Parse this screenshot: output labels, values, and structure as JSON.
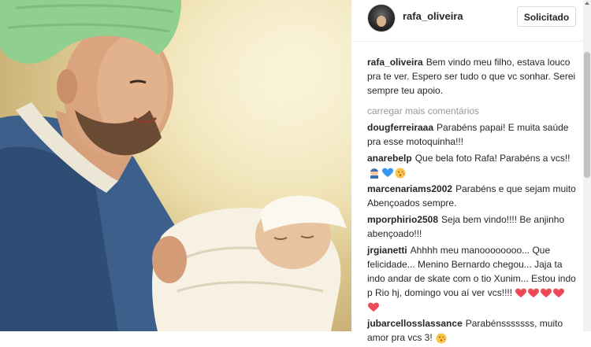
{
  "post": {
    "username": "rafa_oliveira",
    "follow_button": "Solicitado",
    "caption_user": "rafa_oliveira",
    "caption_text": "Bem vindo meu filho, estava louco pra te ver. Espero ser tudo o que vc sonhar. Serei sempre teu apoio.",
    "load_more": "carregar mais comentários"
  },
  "comments": [
    {
      "user": "dougferreiraaa",
      "text": "Parabéns papai! E muita saúde pra esse motoquinha!!!"
    },
    {
      "user": "anarebelp",
      "text": "Que bela foto Rafa! Parabéns a vcs!!"
    },
    {
      "user": "marcenariams2002",
      "text": "Parabéns e que sejam muito Abençoados sempre."
    },
    {
      "user": "mporphirio2508",
      "text": "Seja bem vindo!!!! Be anjinho abençoado!!!"
    },
    {
      "user": "jrgianetti",
      "text": "Ahhhh meu manoooooooo... Que felicidade... Menino Bernardo chegou... Jaja ta indo andar de skate com o tio Xunim... Estou indo p Rio hj, domingo vou aí ver vcs!!!!"
    },
    {
      "user": "jubarcellosslassance",
      "text": "Parabénsssssss, muito amor pra vcs 3!"
    }
  ],
  "colors": {
    "text": "#262626",
    "muted": "#999999",
    "border": "#dbdbdb",
    "heart": "#ed4956",
    "blue_heart": "#3897f0"
  },
  "icons": {
    "comment2": [
      "baby-emoji",
      "blue-heart-emoji",
      "kiss-face-emoji"
    ],
    "comment5": [
      "red-heart-emoji",
      "red-heart-emoji",
      "red-heart-emoji",
      "red-heart-emoji",
      "red-heart-emoji"
    ],
    "comment6": [
      "kiss-face-emoji"
    ]
  }
}
